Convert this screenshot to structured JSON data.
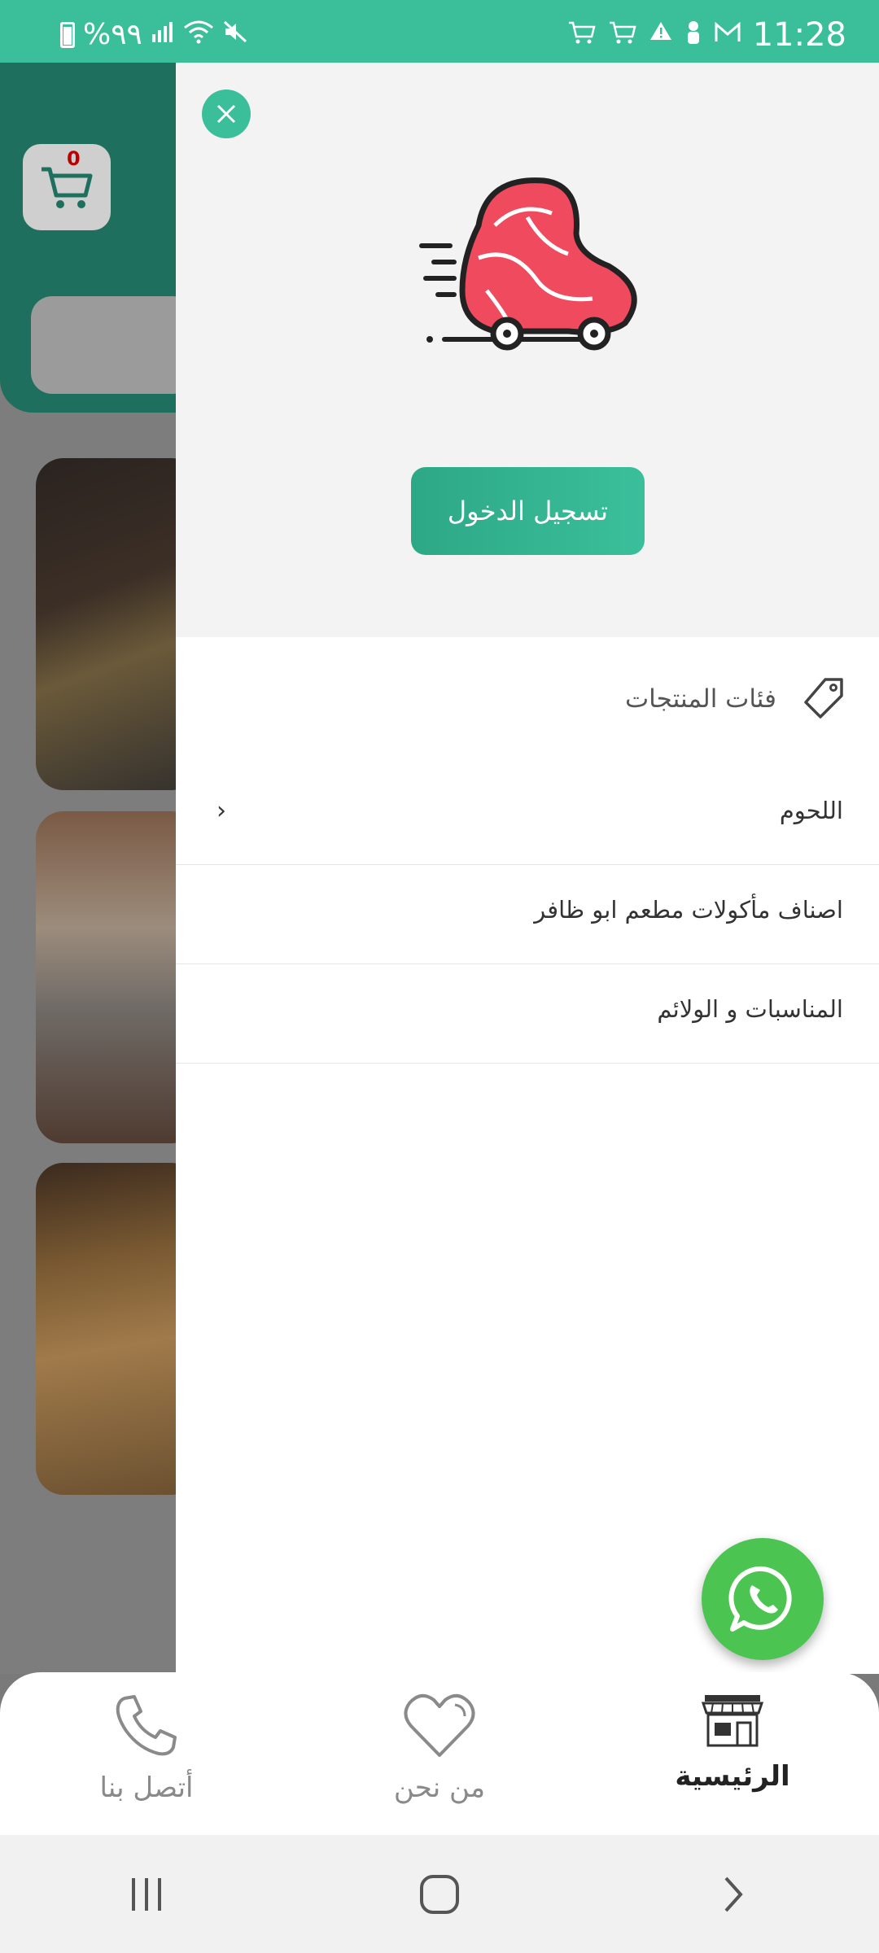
{
  "status_bar": {
    "battery_text": "%٩٩",
    "time": "11:28",
    "icons_left": [
      "battery-icon",
      "signal-icon",
      "wifi-icon",
      "mute-icon"
    ],
    "icons_right": [
      "cart-notification-icon",
      "cart-notification-icon",
      "warning-icon",
      "user-icon",
      "gmail-icon"
    ]
  },
  "background": {
    "cart_count": "0"
  },
  "drawer": {
    "login_label": "تسجيل الدخول",
    "categories_title": "فئات المنتجات",
    "menu": [
      {
        "label": "اللحوم",
        "has_submenu": true
      },
      {
        "label": "اصناف مأكولات مطعم ابو ظافر",
        "has_submenu": false
      },
      {
        "label": "المناسبات و الولائم",
        "has_submenu": false
      }
    ]
  },
  "bottom_nav": {
    "items": [
      {
        "label": "أتصل بنا",
        "icon": "phone-icon"
      },
      {
        "label": "من نحن",
        "icon": "heart-icon"
      },
      {
        "label": "الرئيسية",
        "icon": "store-icon",
        "active": true
      }
    ]
  },
  "colors": {
    "accent": "#3bbf9b",
    "whatsapp": "#4cc452",
    "logo_red": "#ef4a5e"
  }
}
